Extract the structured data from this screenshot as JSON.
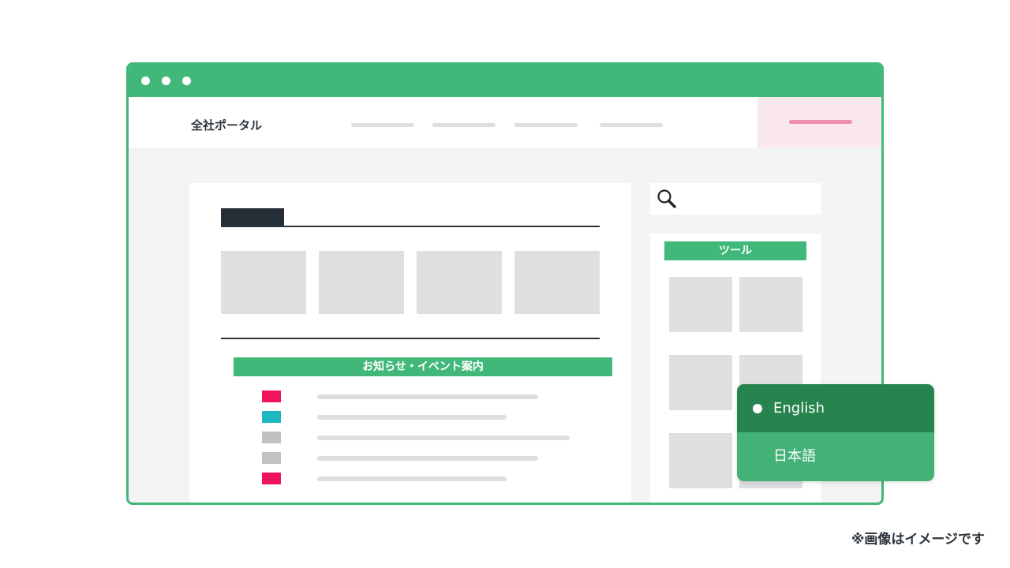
{
  "window": {
    "accent_color": "#41b779",
    "titlebar_dots": [
      "dot",
      "dot",
      "dot"
    ]
  },
  "header": {
    "brand": "全社ポータル",
    "cta_color": "#fbe8ed"
  },
  "main": {
    "news": {
      "title": "お知らせ・イベント案内",
      "items": [
        {
          "tag_color": "#f0145a"
        },
        {
          "tag_color": "#1bb8c0"
        },
        {
          "tag_color": "#c0c1c2"
        },
        {
          "tag_color": "#c0c1c2"
        },
        {
          "tag_color": "#f0145a"
        }
      ]
    }
  },
  "sidebar": {
    "search_icon": "search-icon",
    "tools_title": "ツール"
  },
  "language_menu": {
    "options": [
      {
        "label": "English",
        "selected": true
      },
      {
        "label": "日本語",
        "selected": false
      }
    ]
  },
  "footnote": "※画像はイメージです"
}
